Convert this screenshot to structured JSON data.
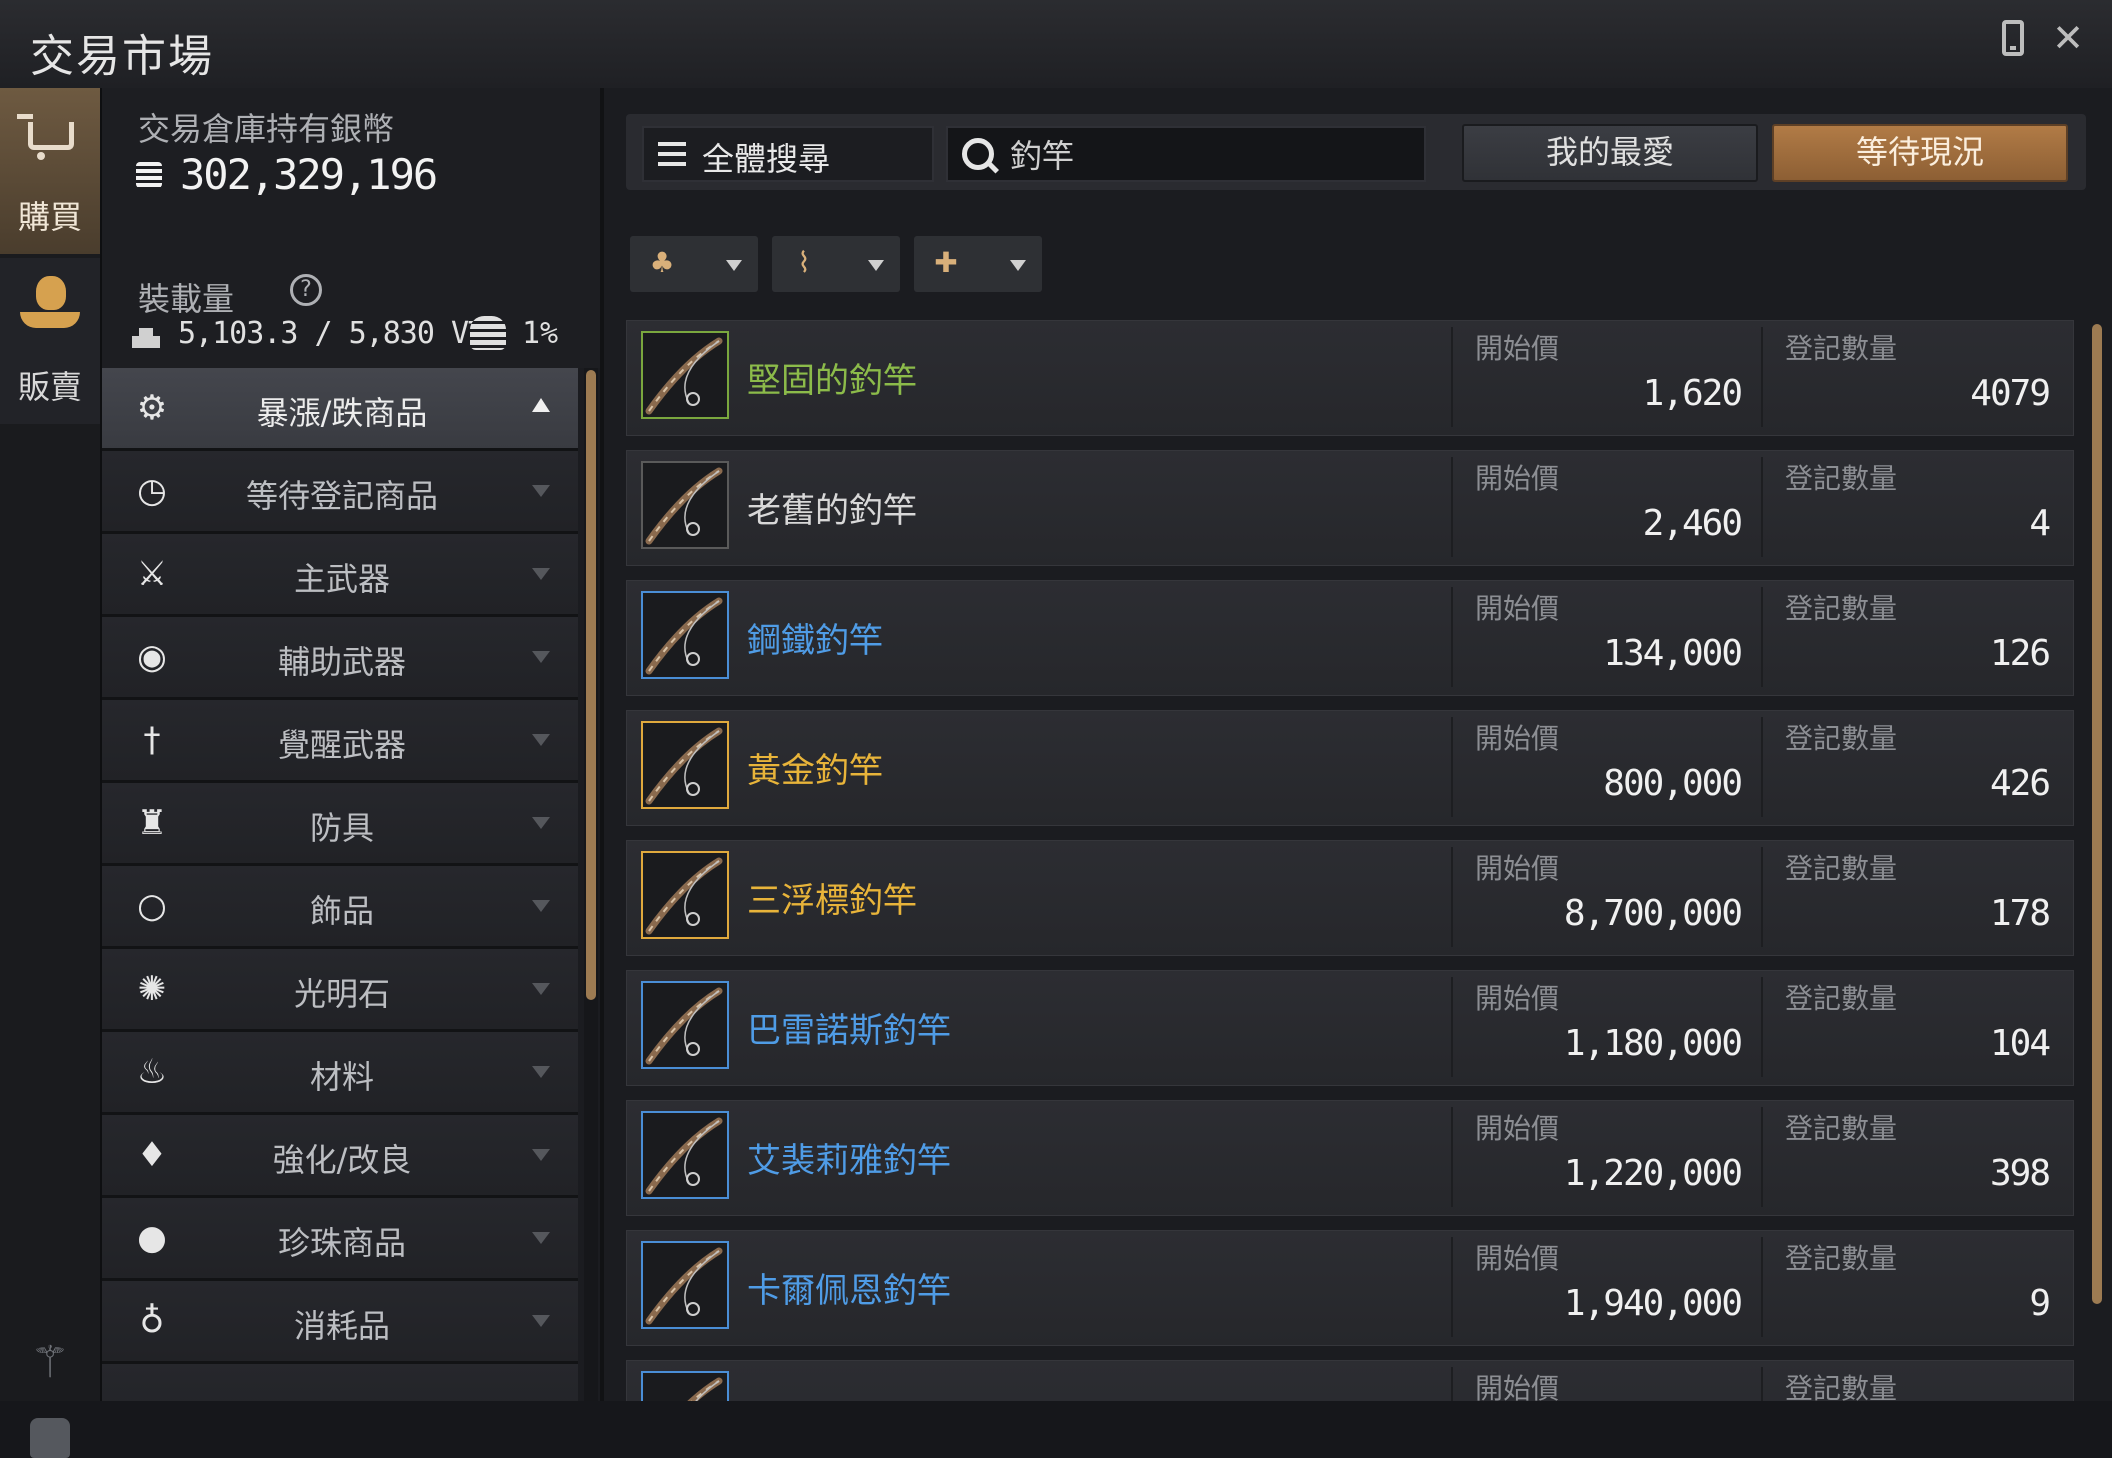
{
  "window": {
    "title": "交易市場"
  },
  "mode_tabs": [
    {
      "label": "購買"
    },
    {
      "label": "販賣"
    }
  ],
  "info": {
    "silver_label": "交易倉庫持有銀幣",
    "silver_value": "302,329,196",
    "weight_label": "裝載量",
    "weight_value": "5,103.3 / 5,830 VT",
    "weight_percent": "1%"
  },
  "categories": [
    {
      "label": "暴漲/跌商品",
      "icon": "gear-icon",
      "active": true
    },
    {
      "label": "等待登記商品",
      "icon": "clock-icon"
    },
    {
      "label": "主武器",
      "icon": "sword-icon"
    },
    {
      "label": "輔助武器",
      "icon": "shield-icon"
    },
    {
      "label": "覺醒武器",
      "icon": "blade-icon"
    },
    {
      "label": "防具",
      "icon": "armor-icon"
    },
    {
      "label": "飾品",
      "icon": "ring-icon"
    },
    {
      "label": "光明石",
      "icon": "crystal-icon"
    },
    {
      "label": "材料",
      "icon": "material-icon"
    },
    {
      "label": "強化/改良",
      "icon": "flame-icon"
    },
    {
      "label": "珍珠商品",
      "icon": "pearl-icon"
    },
    {
      "label": "消耗品",
      "icon": "potion-icon"
    }
  ],
  "search": {
    "scope_label": "全體搜尋",
    "query": "釣竿",
    "favorites_label": "我的最愛",
    "waiting_label": "等待現況"
  },
  "filters": [
    {
      "icon": "money-bag-icon"
    },
    {
      "icon": "trend-icon"
    },
    {
      "icon": "plus-icon"
    }
  ],
  "items": [
    {
      "name": "堅固的釣竿",
      "grade": "green",
      "price_label": "開始價",
      "price": "1,620",
      "count_label": "登記數量",
      "count": "4079"
    },
    {
      "name": "老舊的釣竿",
      "grade": "white",
      "price_label": "開始價",
      "price": "2,460",
      "count_label": "登記數量",
      "count": "4"
    },
    {
      "name": "鋼鐵釣竿",
      "grade": "blue",
      "price_label": "開始價",
      "price": "134,000",
      "count_label": "登記數量",
      "count": "126"
    },
    {
      "name": "黃金釣竿",
      "grade": "gold",
      "price_label": "開始價",
      "price": "800,000",
      "count_label": "登記數量",
      "count": "426"
    },
    {
      "name": "三浮標釣竿",
      "grade": "gold",
      "price_label": "開始價",
      "price": "8,700,000",
      "count_label": "登記數量",
      "count": "178"
    },
    {
      "name": "巴雷諾斯釣竿",
      "grade": "blue",
      "price_label": "開始價",
      "price": "1,180,000",
      "count_label": "登記數量",
      "count": "104"
    },
    {
      "name": "艾裴莉雅釣竿",
      "grade": "blue",
      "price_label": "開始價",
      "price": "1,220,000",
      "count_label": "登記數量",
      "count": "398"
    },
    {
      "name": "卡爾佩恩釣竿",
      "grade": "blue",
      "price_label": "開始價",
      "price": "1,940,000",
      "count_label": "登記數量",
      "count": "9"
    },
    {
      "name": "",
      "grade": "blue",
      "price_label": "開始價",
      "price": "",
      "count_label": "登記數量",
      "count": ""
    }
  ]
}
